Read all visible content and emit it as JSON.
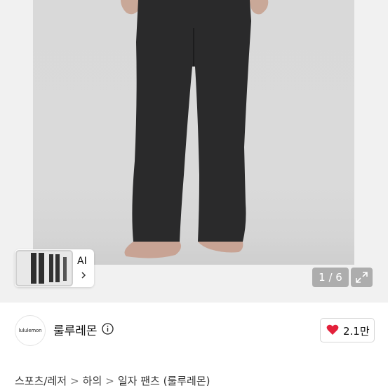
{
  "gallery": {
    "thumb_label": "AI",
    "counter": "1 / 6"
  },
  "seller": {
    "logo_text": "lululemon",
    "name": "룰루레몬"
  },
  "like": {
    "count": "2.1만",
    "color": "#e3213b"
  },
  "breadcrumb": {
    "items": [
      "스포츠/레저",
      "하의",
      "일자 팬츠 (룰루레몬)"
    ],
    "separator": ">"
  }
}
